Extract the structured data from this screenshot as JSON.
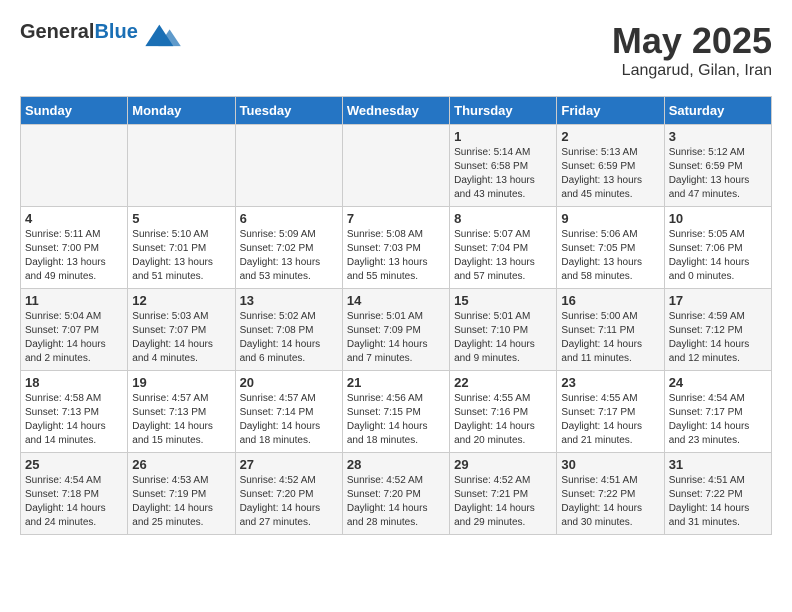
{
  "header": {
    "logo_general": "General",
    "logo_blue": "Blue",
    "month_year": "May 2025",
    "location": "Langarud, Gilan, Iran"
  },
  "weekdays": [
    "Sunday",
    "Monday",
    "Tuesday",
    "Wednesday",
    "Thursday",
    "Friday",
    "Saturday"
  ],
  "weeks": [
    [
      {
        "day": "",
        "sunrise": "",
        "sunset": "",
        "daylight": ""
      },
      {
        "day": "",
        "sunrise": "",
        "sunset": "",
        "daylight": ""
      },
      {
        "day": "",
        "sunrise": "",
        "sunset": "",
        "daylight": ""
      },
      {
        "day": "",
        "sunrise": "",
        "sunset": "",
        "daylight": ""
      },
      {
        "day": "1",
        "sunrise": "Sunrise: 5:14 AM",
        "sunset": "Sunset: 6:58 PM",
        "daylight": "Daylight: 13 hours and 43 minutes."
      },
      {
        "day": "2",
        "sunrise": "Sunrise: 5:13 AM",
        "sunset": "Sunset: 6:59 PM",
        "daylight": "Daylight: 13 hours and 45 minutes."
      },
      {
        "day": "3",
        "sunrise": "Sunrise: 5:12 AM",
        "sunset": "Sunset: 6:59 PM",
        "daylight": "Daylight: 13 hours and 47 minutes."
      }
    ],
    [
      {
        "day": "4",
        "sunrise": "Sunrise: 5:11 AM",
        "sunset": "Sunset: 7:00 PM",
        "daylight": "Daylight: 13 hours and 49 minutes."
      },
      {
        "day": "5",
        "sunrise": "Sunrise: 5:10 AM",
        "sunset": "Sunset: 7:01 PM",
        "daylight": "Daylight: 13 hours and 51 minutes."
      },
      {
        "day": "6",
        "sunrise": "Sunrise: 5:09 AM",
        "sunset": "Sunset: 7:02 PM",
        "daylight": "Daylight: 13 hours and 53 minutes."
      },
      {
        "day": "7",
        "sunrise": "Sunrise: 5:08 AM",
        "sunset": "Sunset: 7:03 PM",
        "daylight": "Daylight: 13 hours and 55 minutes."
      },
      {
        "day": "8",
        "sunrise": "Sunrise: 5:07 AM",
        "sunset": "Sunset: 7:04 PM",
        "daylight": "Daylight: 13 hours and 57 minutes."
      },
      {
        "day": "9",
        "sunrise": "Sunrise: 5:06 AM",
        "sunset": "Sunset: 7:05 PM",
        "daylight": "Daylight: 13 hours and 58 minutes."
      },
      {
        "day": "10",
        "sunrise": "Sunrise: 5:05 AM",
        "sunset": "Sunset: 7:06 PM",
        "daylight": "Daylight: 14 hours and 0 minutes."
      }
    ],
    [
      {
        "day": "11",
        "sunrise": "Sunrise: 5:04 AM",
        "sunset": "Sunset: 7:07 PM",
        "daylight": "Daylight: 14 hours and 2 minutes."
      },
      {
        "day": "12",
        "sunrise": "Sunrise: 5:03 AM",
        "sunset": "Sunset: 7:07 PM",
        "daylight": "Daylight: 14 hours and 4 minutes."
      },
      {
        "day": "13",
        "sunrise": "Sunrise: 5:02 AM",
        "sunset": "Sunset: 7:08 PM",
        "daylight": "Daylight: 14 hours and 6 minutes."
      },
      {
        "day": "14",
        "sunrise": "Sunrise: 5:01 AM",
        "sunset": "Sunset: 7:09 PM",
        "daylight": "Daylight: 14 hours and 7 minutes."
      },
      {
        "day": "15",
        "sunrise": "Sunrise: 5:01 AM",
        "sunset": "Sunset: 7:10 PM",
        "daylight": "Daylight: 14 hours and 9 minutes."
      },
      {
        "day": "16",
        "sunrise": "Sunrise: 5:00 AM",
        "sunset": "Sunset: 7:11 PM",
        "daylight": "Daylight: 14 hours and 11 minutes."
      },
      {
        "day": "17",
        "sunrise": "Sunrise: 4:59 AM",
        "sunset": "Sunset: 7:12 PM",
        "daylight": "Daylight: 14 hours and 12 minutes."
      }
    ],
    [
      {
        "day": "18",
        "sunrise": "Sunrise: 4:58 AM",
        "sunset": "Sunset: 7:13 PM",
        "daylight": "Daylight: 14 hours and 14 minutes."
      },
      {
        "day": "19",
        "sunrise": "Sunrise: 4:57 AM",
        "sunset": "Sunset: 7:13 PM",
        "daylight": "Daylight: 14 hours and 15 minutes."
      },
      {
        "day": "20",
        "sunrise": "Sunrise: 4:57 AM",
        "sunset": "Sunset: 7:14 PM",
        "daylight": "Daylight: 14 hours and 18 minutes."
      },
      {
        "day": "21",
        "sunrise": "Sunrise: 4:56 AM",
        "sunset": "Sunset: 7:15 PM",
        "daylight": "Daylight: 14 hours and 18 minutes."
      },
      {
        "day": "22",
        "sunrise": "Sunrise: 4:55 AM",
        "sunset": "Sunset: 7:16 PM",
        "daylight": "Daylight: 14 hours and 20 minutes."
      },
      {
        "day": "23",
        "sunrise": "Sunrise: 4:55 AM",
        "sunset": "Sunset: 7:17 PM",
        "daylight": "Daylight: 14 hours and 21 minutes."
      },
      {
        "day": "24",
        "sunrise": "Sunrise: 4:54 AM",
        "sunset": "Sunset: 7:17 PM",
        "daylight": "Daylight: 14 hours and 23 minutes."
      }
    ],
    [
      {
        "day": "25",
        "sunrise": "Sunrise: 4:54 AM",
        "sunset": "Sunset: 7:18 PM",
        "daylight": "Daylight: 14 hours and 24 minutes."
      },
      {
        "day": "26",
        "sunrise": "Sunrise: 4:53 AM",
        "sunset": "Sunset: 7:19 PM",
        "daylight": "Daylight: 14 hours and 25 minutes."
      },
      {
        "day": "27",
        "sunrise": "Sunrise: 4:52 AM",
        "sunset": "Sunset: 7:20 PM",
        "daylight": "Daylight: 14 hours and 27 minutes."
      },
      {
        "day": "28",
        "sunrise": "Sunrise: 4:52 AM",
        "sunset": "Sunset: 7:20 PM",
        "daylight": "Daylight: 14 hours and 28 minutes."
      },
      {
        "day": "29",
        "sunrise": "Sunrise: 4:52 AM",
        "sunset": "Sunset: 7:21 PM",
        "daylight": "Daylight: 14 hours and 29 minutes."
      },
      {
        "day": "30",
        "sunrise": "Sunrise: 4:51 AM",
        "sunset": "Sunset: 7:22 PM",
        "daylight": "Daylight: 14 hours and 30 minutes."
      },
      {
        "day": "31",
        "sunrise": "Sunrise: 4:51 AM",
        "sunset": "Sunset: 7:22 PM",
        "daylight": "Daylight: 14 hours and 31 minutes."
      }
    ]
  ]
}
